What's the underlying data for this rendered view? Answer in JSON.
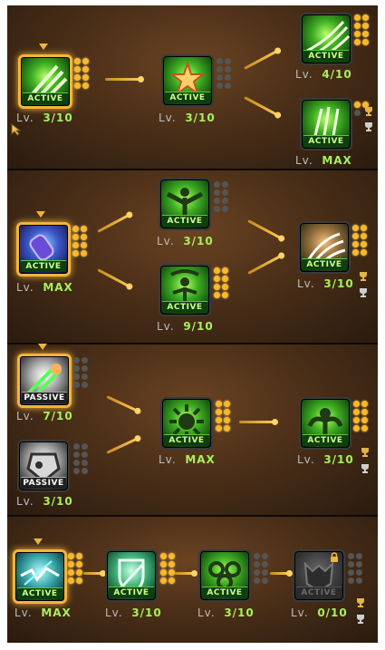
{
  "labels": {
    "active": "ACTIVE",
    "passive": "PASSIVE",
    "lv_prefix": "Lv."
  },
  "colors": {
    "accent": "#f2b43a",
    "level_value": "#a6f05a",
    "point_on": "#f7b82b",
    "point_off": "#555555"
  },
  "rows": [
    {
      "nodes": [
        {
          "name": "claw-slash-skill",
          "level": "3/10",
          "state": "active",
          "selected": true,
          "points_on": 8,
          "points_total": 8
        },
        {
          "name": "star-shield-skill",
          "level": "3/10",
          "state": "active",
          "selected": false,
          "points_on": 0,
          "points_total": 8
        },
        {
          "name": "triple-slash-skill",
          "level": "4/10",
          "state": "active",
          "selected": false,
          "points_on": 8,
          "points_total": 8
        },
        {
          "name": "green-claw-skill",
          "level": "MAX",
          "state": "active",
          "selected": false,
          "points_on": 2,
          "points_total": 3
        }
      ]
    },
    {
      "nodes": [
        {
          "name": "gauntlet-skill",
          "level": "MAX",
          "state": "active",
          "selected": true,
          "points_on": 8,
          "points_total": 8
        },
        {
          "name": "wing-figure-skill",
          "level": "3/10",
          "state": "active",
          "selected": false,
          "points_on": 0,
          "points_total": 8
        },
        {
          "name": "rising-figure-skill",
          "level": "9/10",
          "state": "active",
          "selected": false,
          "points_on": 8,
          "points_total": 8
        },
        {
          "name": "claw-strike-skill",
          "level": "3/10",
          "state": "active",
          "selected": false,
          "points_on": 8,
          "points_total": 8
        }
      ]
    },
    {
      "nodes": [
        {
          "name": "slash-passive-skill",
          "level": "7/10",
          "state": "passive",
          "selected": true,
          "points_on": 0,
          "points_total": 8
        },
        {
          "name": "armor-passive-skill",
          "level": "3/10",
          "state": "passive",
          "selected": false,
          "points_on": 0,
          "points_total": 8
        },
        {
          "name": "burst-skill",
          "level": "MAX",
          "state": "active",
          "selected": false,
          "points_on": 8,
          "points_total": 8
        },
        {
          "name": "power-figure-skill",
          "level": "3/10",
          "state": "active",
          "selected": false,
          "points_on": 8,
          "points_total": 8
        }
      ]
    },
    {
      "nodes": [
        {
          "name": "lightning-claw-skill",
          "level": "MAX",
          "state": "active",
          "selected": true,
          "points_on": 8,
          "points_total": 8
        },
        {
          "name": "shield-sword-skill",
          "level": "3/10",
          "state": "active",
          "selected": false,
          "points_on": 8,
          "points_total": 8
        },
        {
          "name": "chain-skill",
          "level": "3/10",
          "state": "active",
          "selected": false,
          "points_on": 0,
          "points_total": 8
        },
        {
          "name": "locked-beast-skill",
          "level": "0/10",
          "state": "locked",
          "selected": false,
          "points_on": 0,
          "points_total": 8
        }
      ]
    }
  ]
}
